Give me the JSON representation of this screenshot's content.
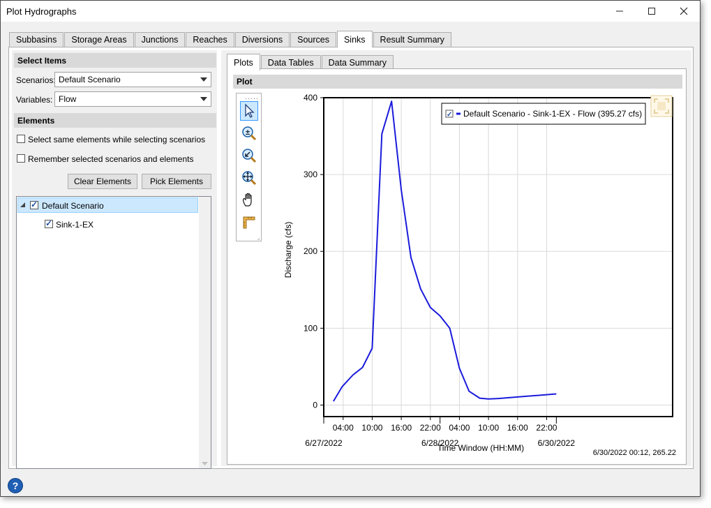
{
  "window": {
    "title": "Plot Hydrographs"
  },
  "top_tabs": [
    {
      "label": "Subbasins",
      "active": false
    },
    {
      "label": "Storage Areas",
      "active": false
    },
    {
      "label": "Junctions",
      "active": false
    },
    {
      "label": "Reaches",
      "active": false
    },
    {
      "label": "Diversions",
      "active": false
    },
    {
      "label": "Sources",
      "active": false
    },
    {
      "label": "Sinks",
      "active": true
    },
    {
      "label": "Result Summary",
      "active": false
    }
  ],
  "left": {
    "select_items_header": "Select Items",
    "scenarios_label": "Scenarios:",
    "scenarios_value": "Default Scenario",
    "variables_label": "Variables:",
    "variables_value": "Flow",
    "elements_header": "Elements",
    "opt_same_elements": "Select same elements while selecting scenarios",
    "opt_remember": "Remember selected scenarios and elements",
    "clear_button": "Clear Elements",
    "pick_button": "Pick Elements",
    "tree": {
      "root": "Default Scenario",
      "child": "Sink-1-EX"
    }
  },
  "right": {
    "tabs": [
      {
        "label": "Plots",
        "active": true
      },
      {
        "label": "Data Tables",
        "active": false
      },
      {
        "label": "Data Summary",
        "active": false
      }
    ],
    "plot_header": "Plot",
    "tools": [
      "pointer-icon",
      "zoom-plus-minus-icon",
      "zoom-back-icon",
      "zoom-extents-icon",
      "pan-hand-icon",
      "measure-icon"
    ],
    "cursor_readout": "6/30/2022 00:12, 265.22"
  },
  "chart_data": {
    "type": "line",
    "xlabel": "Time Window (HH:MM)",
    "ylabel": "Discharge (cfs)",
    "x_unit": "hours from 6/27/2022 00:00",
    "xlim": [
      0,
      72
    ],
    "ylim": [
      -15,
      400
    ],
    "yticks": [
      0,
      100,
      200,
      300,
      400
    ],
    "xticks": [
      {
        "x": 4,
        "label": "04:00"
      },
      {
        "x": 10,
        "label": "10:00"
      },
      {
        "x": 16,
        "label": "16:00"
      },
      {
        "x": 22,
        "label": "22:00"
      },
      {
        "x": 28,
        "label": "04:00"
      },
      {
        "x": 34,
        "label": "10:00"
      },
      {
        "x": 40,
        "label": "16:00"
      },
      {
        "x": 46,
        "label": "22:00"
      }
    ],
    "date_labels": [
      {
        "x": 0,
        "label": "6/27/2022"
      },
      {
        "x": 24,
        "label": "6/28/2022"
      },
      {
        "x": 48,
        "label": "6/30/2022"
      }
    ],
    "grid": true,
    "legend_position": "top-right",
    "series": [
      {
        "name": "Default Scenario - Sink-1-EX - Flow (395.27 cfs)",
        "color": "#1a1adc",
        "x": [
          2,
          3.8,
          6,
          8,
          10,
          12,
          14,
          16,
          18,
          20,
          22,
          24,
          26,
          28,
          30,
          32.2,
          34,
          36,
          38,
          40,
          42,
          44,
          46,
          48
        ],
        "y": [
          5,
          24,
          39,
          49,
          74,
          353,
          395.27,
          280,
          192,
          151,
          127,
          116,
          100,
          48,
          18,
          9,
          8,
          8.5,
          9.5,
          10.5,
          11.5,
          12.5,
          13.5,
          14.5
        ]
      }
    ]
  }
}
